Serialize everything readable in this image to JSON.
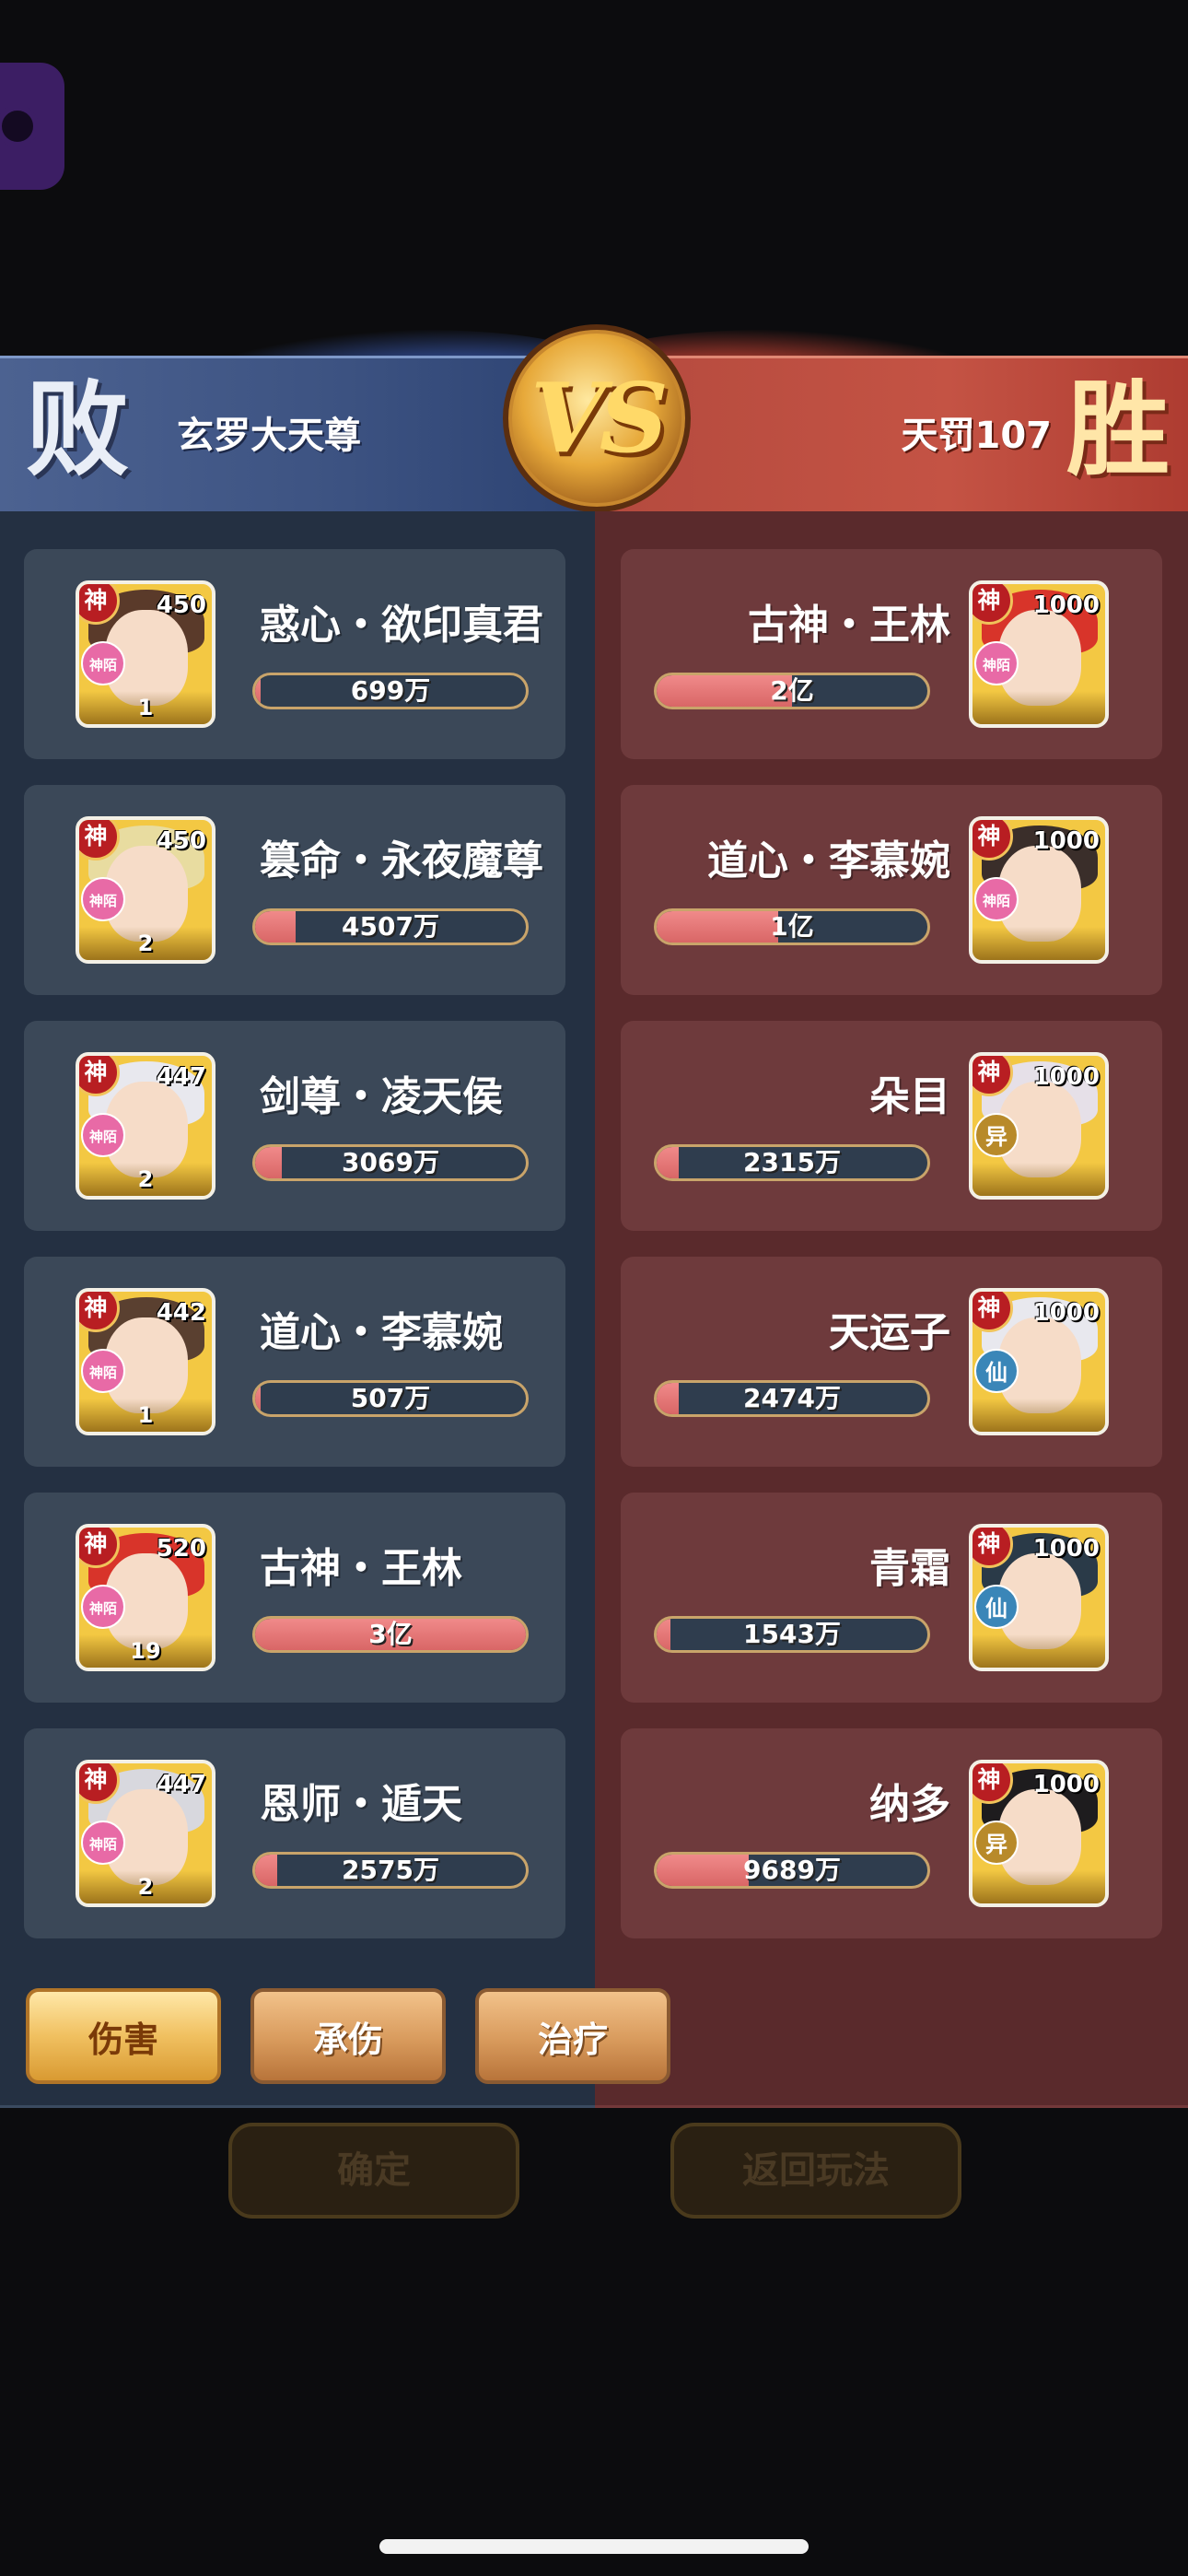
{
  "banner": {
    "left_result": "败",
    "right_result": "胜",
    "left_player": "玄罗大天尊",
    "right_player": "天罚107",
    "vs": "VS"
  },
  "colors": {
    "left_team": "#243042",
    "right_team": "#5a2a2c",
    "bar_fill": "#e07070",
    "shen_badge": "#b81e22"
  },
  "left_heroes": [
    {
      "name": "惑心・欲印真君",
      "level": "450",
      "badge": "神",
      "sub_badge": "神陌",
      "stars": "1",
      "value": "699万",
      "fill_ratio": 0.01
    },
    {
      "name": "篡命・永夜魔尊",
      "level": "450",
      "badge": "神",
      "sub_badge": "神陌",
      "stars": "2",
      "value": "4507万",
      "fill_ratio": 0.15
    },
    {
      "name": "剑尊・凌天侯",
      "level": "447",
      "badge": "神",
      "sub_badge": "神陌",
      "stars": "2",
      "value": "3069万",
      "fill_ratio": 0.1
    },
    {
      "name": "道心・李慕婉",
      "level": "442",
      "badge": "神",
      "sub_badge": "神陌",
      "stars": "1",
      "value": "507万",
      "fill_ratio": 0.01
    },
    {
      "name": "古神・王林",
      "level": "520",
      "badge": "神",
      "sub_badge": "神陌",
      "stars": "19",
      "value": "3亿",
      "fill_ratio": 1.0
    },
    {
      "name": "恩师・遁天",
      "level": "447",
      "badge": "神",
      "sub_badge": "神陌",
      "stars": "2",
      "value": "2575万",
      "fill_ratio": 0.08
    }
  ],
  "right_heroes": [
    {
      "name": "古神・王林",
      "level": "1000",
      "badge": "神",
      "sub_badge": "神陌",
      "value": "2亿",
      "fill_ratio": 0.5
    },
    {
      "name": "道心・李慕婉",
      "level": "1000",
      "badge": "神",
      "sub_badge": "神陌",
      "value": "1亿",
      "fill_ratio": 0.45
    },
    {
      "name": "朵目",
      "level": "1000",
      "badge": "神",
      "sub_badge": "异",
      "value": "2315万",
      "fill_ratio": 0.08
    },
    {
      "name": "天运子",
      "level": "1000",
      "badge": "神",
      "sub_badge": "仙",
      "value": "2474万",
      "fill_ratio": 0.08
    },
    {
      "name": "青霜",
      "level": "1000",
      "badge": "神",
      "sub_badge": "仙",
      "value": "1543万",
      "fill_ratio": 0.05
    },
    {
      "name": "纳多",
      "level": "1000",
      "badge": "神",
      "sub_badge": "异",
      "value": "9689万",
      "fill_ratio": 0.34
    }
  ],
  "tabs": [
    {
      "label": "伤害",
      "active": true
    },
    {
      "label": "承伤",
      "active": false
    },
    {
      "label": "治疗",
      "active": false
    }
  ],
  "buttons": {
    "confirm": "确定",
    "back": "返回玩法"
  }
}
